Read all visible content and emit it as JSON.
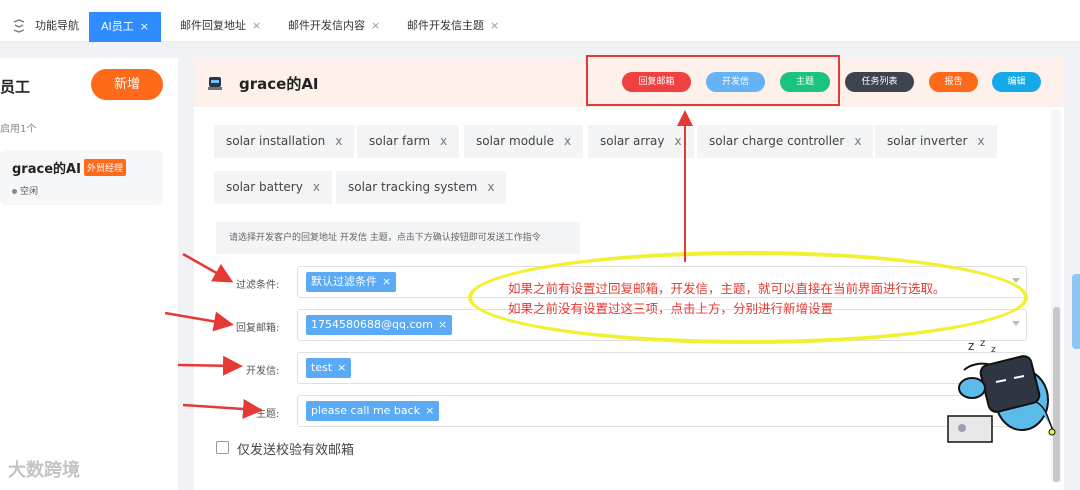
{
  "topbar": {
    "tabs": [
      {
        "label": "功能导航",
        "closable": false,
        "active": false
      },
      {
        "label": "AI员工",
        "closable": true,
        "active": true
      },
      {
        "label": "邮件回复地址",
        "closable": true,
        "active": false
      },
      {
        "label": "邮件开发信内容",
        "closable": true,
        "active": false
      },
      {
        "label": "邮件开发信主题",
        "closable": true,
        "active": false
      }
    ],
    "close_glyph": "×"
  },
  "sidebar": {
    "title": "员工",
    "add_button": "新增",
    "count_text": "启用1个",
    "card": {
      "name": "grace的AI",
      "badge": "外贸经理",
      "status": "空闲"
    }
  },
  "header": {
    "name": "grace的AI",
    "avatar_icon": "robot-avatar-icon",
    "actions": [
      {
        "label": "回复邮箱",
        "color": "#f04141"
      },
      {
        "label": "开发信",
        "color": "#63b3f6"
      },
      {
        "label": "主题",
        "color": "#1bc47d"
      },
      {
        "label": "任务列表",
        "color": "#3d4450"
      },
      {
        "label": "报告",
        "color": "#ff6a1a"
      },
      {
        "label": "编辑",
        "color": "#16a9e8"
      }
    ]
  },
  "keywords": [
    "solar installation",
    "solar farm",
    "solar module",
    "solar array",
    "solar charge controller",
    "solar inverter",
    "solar battery",
    "solar tracking system"
  ],
  "keyword_close": "x",
  "hint_text": "请选择开发客户的回复地址 开发信 主题，点击下方确认按钮即可发送工作指令",
  "form": {
    "filter": {
      "label": "过滤条件:",
      "value": "默认过滤条件"
    },
    "reply": {
      "label": "回复邮箱:",
      "value": "1754580688@qq.com"
    },
    "letter": {
      "label": "开发信:",
      "value": "test"
    },
    "subject": {
      "label": "主题:",
      "value": "please call me back"
    },
    "chip_close": "×",
    "checkbox_label": "仅发送校验有效邮箱"
  },
  "annotation": {
    "line1": "如果之前有设置过回复邮箱，开发信，主题，就可以直接在当前界面进行选取。",
    "line2": "如果之前没有设置过这三项，点击上方，分别进行新增设置",
    "color": "#e53935",
    "ellipse_color": "#f2f032"
  },
  "watermark": "大数跨境"
}
